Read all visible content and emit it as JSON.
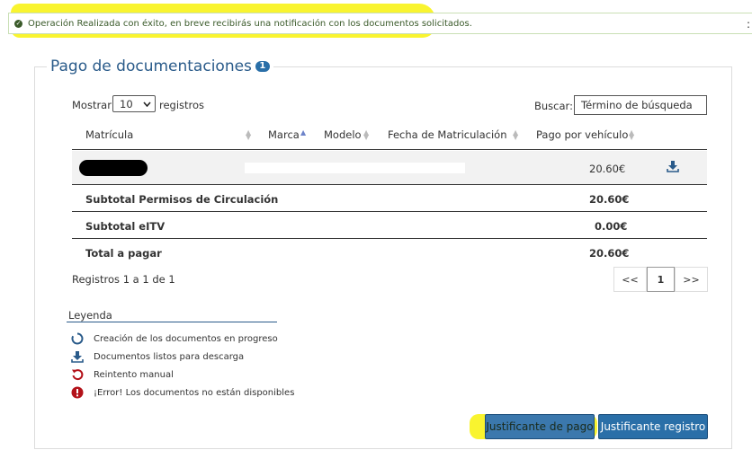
{
  "alert": {
    "message": "Operación Realizada con éxito, en breve recibirás una notificación con los documentos solicitados."
  },
  "panel": {
    "title": "Pago de documentaciones",
    "badge": "1"
  },
  "table_controls": {
    "show_label": "Mostrar",
    "page_size": "10",
    "records_label": "registros",
    "search_label": "Buscar:",
    "search_placeholder": "Término de búsqueda"
  },
  "table": {
    "headers": [
      "Matrícula",
      "Marca",
      "Modelo",
      "Fecha de Matriculación",
      "Pago por vehículo"
    ],
    "row": {
      "amount": "20.60€"
    },
    "subtotals": [
      {
        "label": "Subtotal Permisos de Circulación",
        "value": "20.60€"
      },
      {
        "label": "Subtotal eITV",
        "value": "0.00€"
      },
      {
        "label": "Total a pagar",
        "value": "20.60€"
      }
    ],
    "info": "Registros 1 a 1 de 1"
  },
  "pagination": {
    "prev": "<<",
    "current": "1",
    "next": ">>"
  },
  "legend": {
    "title": "Leyenda",
    "items": [
      "Creación de los documentos en progreso",
      "Documentos listos para descarga",
      "Reintento manual",
      "¡Error! Los documentos no están disponibles"
    ]
  },
  "buttons": {
    "receipt": "Justificante de pago",
    "registry": "Justificante registro"
  },
  "colors": {
    "primary": "#2a6fa8",
    "highlight": "#f8f20a",
    "error": "#b3121a"
  }
}
